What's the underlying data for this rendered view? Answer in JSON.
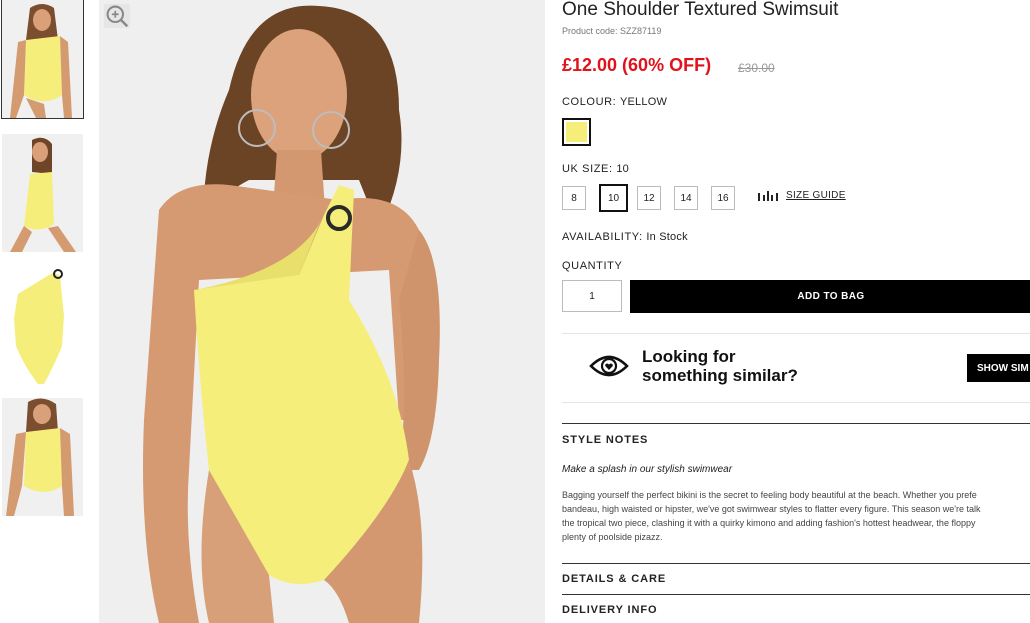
{
  "product": {
    "title": "One Shoulder Textured Swimsuit",
    "code": "Product code: SZZ87119",
    "price": "£12.00 (60% OFF)",
    "old_price": "£30.00"
  },
  "colour": {
    "label": "COLOUR:",
    "value": "YELLOW",
    "swatch_color": "#f6ee7b"
  },
  "size": {
    "label": "UK SIZE:",
    "value": "10",
    "options": [
      "8",
      "10",
      "12",
      "14",
      "16"
    ],
    "selected": "10",
    "guide_label": "SIZE GUIDE"
  },
  "availability": {
    "label": "AVAILABILITY:",
    "value": "In Stock"
  },
  "quantity": {
    "label": "QUANTITY",
    "value": "1"
  },
  "add_to_bag": "ADD TO BAG",
  "similar": {
    "line1": "Looking for",
    "line2": "something similar?",
    "button": "SHOW SIM"
  },
  "style_notes": {
    "title": "STYLE NOTES",
    "intro": "Make a splash in our stylish swimwear",
    "body": [
      "Bagging yourself the perfect bikini is the secret to feeling body beautiful at the beach. Whether you prefe",
      "bandeau, high waisted or hipster, we've got swimwear styles to flatter every figure. This season we're talk",
      "the tropical two piece, clashing it with a quirky kimono and adding fashion's hottest headwear, the floppy",
      "plenty of poolside pizazz."
    ]
  },
  "details_title": "DETAILS & CARE",
  "delivery_title": "DELIVERY INFO",
  "colors": {
    "price_red": "#e0131d",
    "swimsuit_yellow": "#f6ee7b",
    "button_black": "#000000"
  },
  "icons": {
    "zoom": "zoom-in-icon",
    "size_guide": "ruler-icon",
    "similar": "eye-heart-icon"
  }
}
